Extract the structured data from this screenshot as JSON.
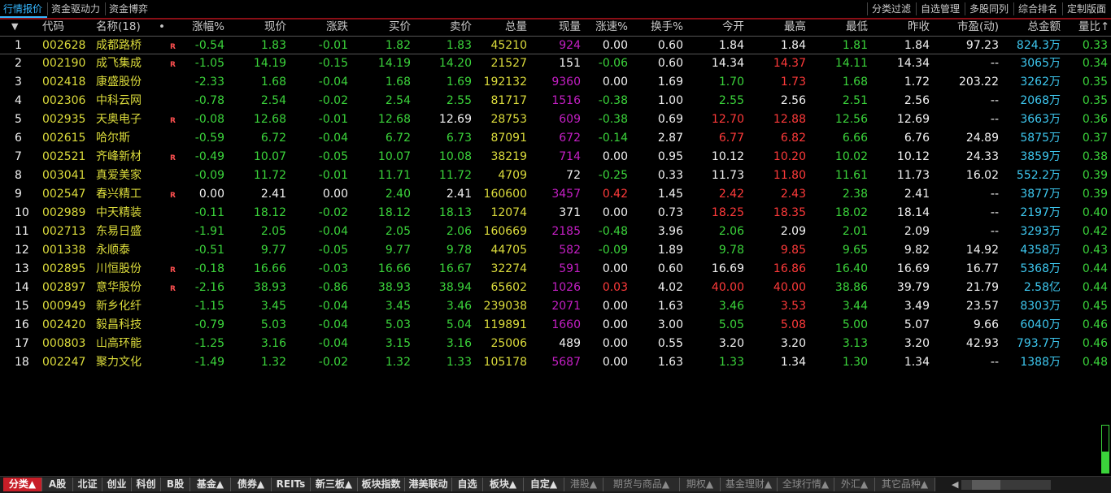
{
  "top_tabs": [
    "行情报价",
    "资金驱动力",
    "资金博弈"
  ],
  "right_tabs": [
    "分类过滤",
    "自选管理",
    "多股同列",
    "综合排名",
    "定制版面"
  ],
  "headers": {
    "sort_arrow": "▼",
    "code": "代码",
    "name": "名称(18)",
    "dot": "•",
    "pct": "涨幅%",
    "price": "现价",
    "change": "涨跌",
    "bid": "买价",
    "ask": "卖价",
    "volume": "总量",
    "cur_vol": "现量",
    "speed": "涨速%",
    "turnover": "换手%",
    "open": "今开",
    "high": "最高",
    "low": "最低",
    "prev_close": "昨收",
    "pe": "市盈(动)",
    "amount": "总金额",
    "vol_ratio": "量比↑"
  },
  "rows": [
    {
      "idx": "1",
      "code": "002628",
      "name": "成都路桥",
      "r": "R",
      "pct": "-0.54",
      "price": "1.83",
      "change": "-0.01",
      "bid": "1.82",
      "ask": "1.83",
      "volume": "45210",
      "cur_vol": "924",
      "speed": "0.00",
      "turnover": "0.60",
      "open": "1.84",
      "high": "1.84",
      "low": "1.81",
      "prev_close": "1.84",
      "pe": "97.23",
      "amount": "824.3万",
      "vol_ratio": "0.33"
    },
    {
      "idx": "2",
      "code": "002190",
      "name": "成飞集成",
      "r": "R",
      "pct": "-1.05",
      "price": "14.19",
      "change": "-0.15",
      "bid": "14.19",
      "ask": "14.20",
      "volume": "21527",
      "cur_vol": "151",
      "speed": "-0.06",
      "turnover": "0.60",
      "open": "14.34",
      "high": "14.37",
      "low": "14.11",
      "prev_close": "14.34",
      "pe": "--",
      "amount": "3065万",
      "vol_ratio": "0.34"
    },
    {
      "idx": "3",
      "code": "002418",
      "name": "康盛股份",
      "r": "",
      "pct": "-2.33",
      "price": "1.68",
      "change": "-0.04",
      "bid": "1.68",
      "ask": "1.69",
      "volume": "192132",
      "cur_vol": "9360",
      "speed": "0.00",
      "turnover": "1.69",
      "open": "1.70",
      "high": "1.73",
      "low": "1.68",
      "prev_close": "1.72",
      "pe": "203.22",
      "amount": "3262万",
      "vol_ratio": "0.35"
    },
    {
      "idx": "4",
      "code": "002306",
      "name": "中科云网",
      "r": "",
      "pct": "-0.78",
      "price": "2.54",
      "change": "-0.02",
      "bid": "2.54",
      "ask": "2.55",
      "volume": "81717",
      "cur_vol": "1516",
      "speed": "-0.38",
      "turnover": "1.00",
      "open": "2.55",
      "high": "2.56",
      "low": "2.51",
      "prev_close": "2.56",
      "pe": "--",
      "amount": "2068万",
      "vol_ratio": "0.35"
    },
    {
      "idx": "5",
      "code": "002935",
      "name": "天奥电子",
      "r": "R",
      "pct": "-0.08",
      "price": "12.68",
      "change": "-0.01",
      "bid": "12.68",
      "ask": "12.69",
      "volume": "28753",
      "cur_vol": "609",
      "speed": "-0.38",
      "turnover": "0.69",
      "open": "12.70",
      "high": "12.88",
      "low": "12.56",
      "prev_close": "12.69",
      "pe": "--",
      "amount": "3663万",
      "vol_ratio": "0.36"
    },
    {
      "idx": "6",
      "code": "002615",
      "name": "哈尔斯",
      "r": "",
      "pct": "-0.59",
      "price": "6.72",
      "change": "-0.04",
      "bid": "6.72",
      "ask": "6.73",
      "volume": "87091",
      "cur_vol": "672",
      "speed": "-0.14",
      "turnover": "2.87",
      "open": "6.77",
      "high": "6.82",
      "low": "6.66",
      "prev_close": "6.76",
      "pe": "24.89",
      "amount": "5875万",
      "vol_ratio": "0.37"
    },
    {
      "idx": "7",
      "code": "002521",
      "name": "齐峰新材",
      "r": "R",
      "pct": "-0.49",
      "price": "10.07",
      "change": "-0.05",
      "bid": "10.07",
      "ask": "10.08",
      "volume": "38219",
      "cur_vol": "714",
      "speed": "0.00",
      "turnover": "0.95",
      "open": "10.12",
      "high": "10.20",
      "low": "10.02",
      "prev_close": "10.12",
      "pe": "24.33",
      "amount": "3859万",
      "vol_ratio": "0.38"
    },
    {
      "idx": "8",
      "code": "003041",
      "name": "真爱美家",
      "r": "",
      "pct": "-0.09",
      "price": "11.72",
      "change": "-0.01",
      "bid": "11.71",
      "ask": "11.72",
      "volume": "4709",
      "cur_vol": "72",
      "speed": "-0.25",
      "turnover": "0.33",
      "open": "11.73",
      "high": "11.80",
      "low": "11.61",
      "prev_close": "11.73",
      "pe": "16.02",
      "amount": "552.2万",
      "vol_ratio": "0.39"
    },
    {
      "idx": "9",
      "code": "002547",
      "name": "春兴精工",
      "r": "R",
      "pct": "0.00",
      "price": "2.41",
      "change": "0.00",
      "bid": "2.40",
      "ask": "2.41",
      "volume": "160600",
      "cur_vol": "3457",
      "speed": "0.42",
      "turnover": "1.45",
      "open": "2.42",
      "high": "2.43",
      "low": "2.38",
      "prev_close": "2.41",
      "pe": "--",
      "amount": "3877万",
      "vol_ratio": "0.39"
    },
    {
      "idx": "10",
      "code": "002989",
      "name": "中天精装",
      "r": "",
      "pct": "-0.11",
      "price": "18.12",
      "change": "-0.02",
      "bid": "18.12",
      "ask": "18.13",
      "volume": "12074",
      "cur_vol": "371",
      "speed": "0.00",
      "turnover": "0.73",
      "open": "18.25",
      "high": "18.35",
      "low": "18.02",
      "prev_close": "18.14",
      "pe": "--",
      "amount": "2197万",
      "vol_ratio": "0.40"
    },
    {
      "idx": "11",
      "code": "002713",
      "name": "东易日盛",
      "r": "",
      "pct": "-1.91",
      "price": "2.05",
      "change": "-0.04",
      "bid": "2.05",
      "ask": "2.06",
      "volume": "160669",
      "cur_vol": "2185",
      "speed": "-0.48",
      "turnover": "3.96",
      "open": "2.06",
      "high": "2.09",
      "low": "2.01",
      "prev_close": "2.09",
      "pe": "--",
      "amount": "3293万",
      "vol_ratio": "0.42"
    },
    {
      "idx": "12",
      "code": "001338",
      "name": "永顺泰",
      "r": "",
      "pct": "-0.51",
      "price": "9.77",
      "change": "-0.05",
      "bid": "9.77",
      "ask": "9.78",
      "volume": "44705",
      "cur_vol": "582",
      "speed": "-0.09",
      "turnover": "1.89",
      "open": "9.78",
      "high": "9.85",
      "low": "9.65",
      "prev_close": "9.82",
      "pe": "14.92",
      "amount": "4358万",
      "vol_ratio": "0.43"
    },
    {
      "idx": "13",
      "code": "002895",
      "name": "川恒股份",
      "r": "R",
      "pct": "-0.18",
      "price": "16.66",
      "change": "-0.03",
      "bid": "16.66",
      "ask": "16.67",
      "volume": "32274",
      "cur_vol": "591",
      "speed": "0.00",
      "turnover": "0.60",
      "open": "16.69",
      "high": "16.86",
      "low": "16.40",
      "prev_close": "16.69",
      "pe": "16.77",
      "amount": "5368万",
      "vol_ratio": "0.44"
    },
    {
      "idx": "14",
      "code": "002897",
      "name": "意华股份",
      "r": "R",
      "pct": "-2.16",
      "price": "38.93",
      "change": "-0.86",
      "bid": "38.93",
      "ask": "38.94",
      "volume": "65602",
      "cur_vol": "1026",
      "speed": "0.03",
      "turnover": "4.02",
      "open": "40.00",
      "high": "40.00",
      "low": "38.86",
      "prev_close": "39.79",
      "pe": "21.79",
      "amount": "2.58亿",
      "vol_ratio": "0.44"
    },
    {
      "idx": "15",
      "code": "000949",
      "name": "新乡化纤",
      "r": "",
      "pct": "-1.15",
      "price": "3.45",
      "change": "-0.04",
      "bid": "3.45",
      "ask": "3.46",
      "volume": "239038",
      "cur_vol": "2071",
      "speed": "0.00",
      "turnover": "1.63",
      "open": "3.46",
      "high": "3.53",
      "low": "3.44",
      "prev_close": "3.49",
      "pe": "23.57",
      "amount": "8303万",
      "vol_ratio": "0.45"
    },
    {
      "idx": "16",
      "code": "002420",
      "name": "毅昌科技",
      "r": "",
      "pct": "-0.79",
      "price": "5.03",
      "change": "-0.04",
      "bid": "5.03",
      "ask": "5.04",
      "volume": "119891",
      "cur_vol": "1660",
      "speed": "0.00",
      "turnover": "3.00",
      "open": "5.05",
      "high": "5.08",
      "low": "5.00",
      "prev_close": "5.07",
      "pe": "9.66",
      "amount": "6040万",
      "vol_ratio": "0.46"
    },
    {
      "idx": "17",
      "code": "000803",
      "name": "山高环能",
      "r": "",
      "pct": "-1.25",
      "price": "3.16",
      "change": "-0.04",
      "bid": "3.15",
      "ask": "3.16",
      "volume": "25006",
      "cur_vol": "489",
      "speed": "0.00",
      "turnover": "0.55",
      "open": "3.20",
      "high": "3.20",
      "low": "3.13",
      "prev_close": "3.20",
      "pe": "42.93",
      "amount": "793.7万",
      "vol_ratio": "0.46"
    },
    {
      "idx": "18",
      "code": "002247",
      "name": "聚力文化",
      "r": "",
      "pct": "-1.49",
      "price": "1.32",
      "change": "-0.02",
      "bid": "1.32",
      "ask": "1.33",
      "volume": "105178",
      "cur_vol": "5687",
      "speed": "0.00",
      "turnover": "1.63",
      "open": "1.33",
      "high": "1.34",
      "low": "1.30",
      "prev_close": "1.34",
      "pe": "--",
      "amount": "1388万",
      "vol_ratio": "0.48"
    }
  ],
  "bottom_tabs": [
    {
      "label": "分类▲",
      "state": "active"
    },
    {
      "label": "A股",
      "state": ""
    },
    {
      "label": "北证",
      "state": ""
    },
    {
      "label": "创业",
      "state": ""
    },
    {
      "label": "科创",
      "state": ""
    },
    {
      "label": "B股",
      "state": ""
    },
    {
      "label": "基金▲",
      "state": ""
    },
    {
      "label": "债券▲",
      "state": ""
    },
    {
      "label": "REITs",
      "state": ""
    },
    {
      "label": "新三板▲",
      "state": ""
    },
    {
      "label": "板块指数",
      "state": ""
    },
    {
      "label": "港美联动",
      "state": ""
    },
    {
      "label": "自选",
      "state": ""
    },
    {
      "label": "板块▲",
      "state": ""
    },
    {
      "label": "自定▲",
      "state": ""
    },
    {
      "label": "港股▲",
      "state": "dim"
    },
    {
      "label": "期货与商品▲",
      "state": "dim"
    },
    {
      "label": "期权▲",
      "state": "dim"
    },
    {
      "label": "基金理财▲",
      "state": "dim"
    },
    {
      "label": "全球行情▲",
      "state": "dim"
    },
    {
      "label": "外汇▲",
      "state": "dim"
    },
    {
      "label": "其它品种▲",
      "state": "dim"
    }
  ],
  "scroll_left_arrow": "◀",
  "volume_gauge_level": 0.45,
  "colors": {
    "up": "#ff3a3a",
    "down": "#3bd43b",
    "flat": "#f2f2f2",
    "volume": "#dcdc3c",
    "cur_vol": "#c51fc5",
    "amount": "#3ec8f0",
    "accent": "#c81e28"
  }
}
